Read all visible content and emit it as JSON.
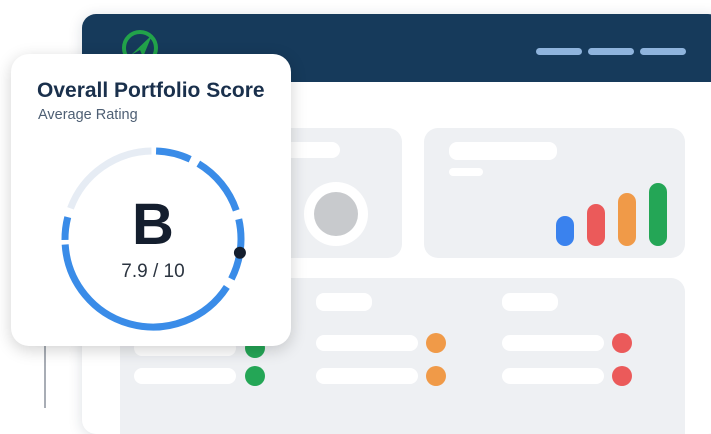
{
  "score_card": {
    "title": "Overall Portfolio Score",
    "subtitle": "Average Rating",
    "grade": "B",
    "score": "7.9 / 10",
    "score_fraction": 0.79
  },
  "icons": {
    "logo": "compass-logo-icon"
  },
  "colors": {
    "header": "#163a5b",
    "gauge_fill": "#3a8ce8",
    "gauge_track": "#e6ecf4",
    "logo_green": "#22a34a",
    "bar_blue": "#3a82ee",
    "bar_red": "#eb5a5a",
    "bar_orange": "#f09a48",
    "bar_green": "#24a656",
    "status_green": "#24a656",
    "status_orange": "#f09a48",
    "status_red": "#eb5a5a"
  }
}
